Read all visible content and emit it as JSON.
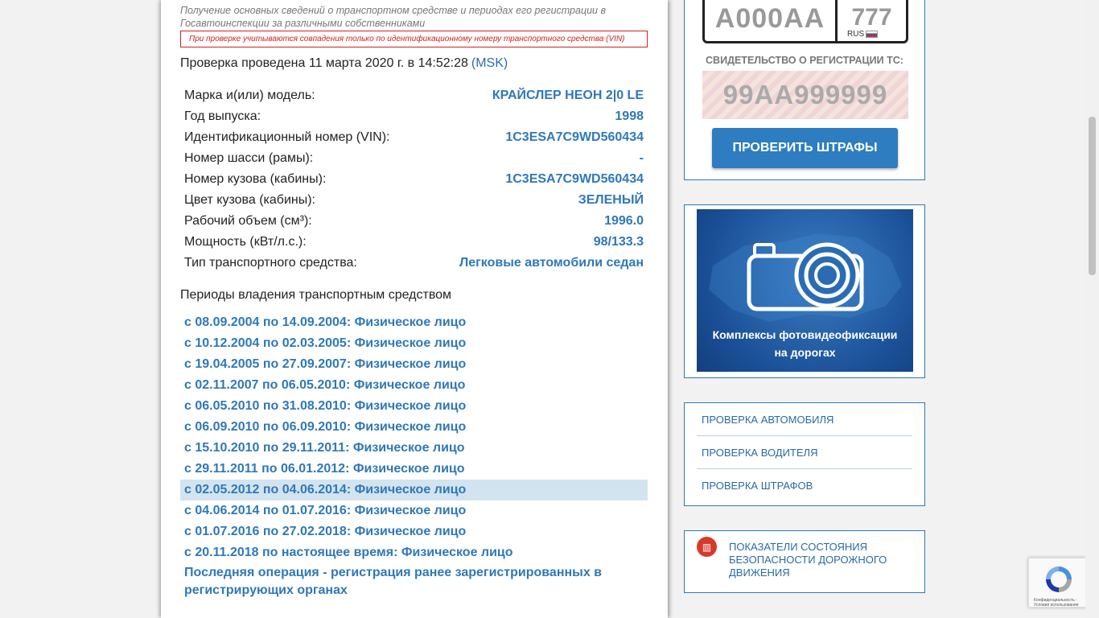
{
  "report": {
    "intro": "Получение основных сведений о транспортном средстве и периодах его регистрации в Госавтоинспекции за различными собственниками",
    "vin_note": "При проверке учитываются совпадения только по идентификационному номеру транспортного средства (VIN)",
    "check_time": "Проверка проведена 11 марта 2020 г. в 14:52:28",
    "timezone": "(MSK)"
  },
  "vehicle": [
    {
      "label": "Марка и(или) модель:",
      "value": "КРАЙСЛЕР НЕОН 2|0 LE"
    },
    {
      "label": "Год выпуска:",
      "value": "1998"
    },
    {
      "label": "Идентификационный номер (VIN):",
      "value": "1C3ESA7C9WD560434"
    },
    {
      "label": "Номер шасси (рамы):",
      "value": "-"
    },
    {
      "label": "Номер кузова (кабины):",
      "value": "1C3ESA7C9WD560434"
    },
    {
      "label": "Цвет кузова (кабины):",
      "value": "ЗЕЛЕНЫЙ"
    },
    {
      "label": "Рабочий объем (см³):",
      "value": "1996.0"
    },
    {
      "label": "Мощность (кВт/л.с.):",
      "value": "98/133.3"
    },
    {
      "label": "Тип транспортного средства:",
      "value": "Легковые автомобили седан"
    }
  ],
  "ownership": {
    "title": "Периоды владения транспортным средством",
    "periods": [
      "с 08.09.2004 по 14.09.2004: Физическое лицо",
      "с 10.12.2004 по 02.03.2005: Физическое лицо",
      "с 19.04.2005 по 27.09.2007: Физическое лицо",
      "с 02.11.2007 по 06.05.2010: Физическое лицо",
      "с 06.05.2010 по 31.08.2010: Физическое лицо",
      "с 06.09.2010 по 06.09.2010: Физическое лицо",
      "с 15.10.2010 по 29.11.2011: Физическое лицо",
      "с 29.11.2011 по 06.01.2012: Физическое лицо",
      "с 02.05.2012 по 04.06.2014: Физическое лицо",
      "с 04.06.2014 по 01.07.2016: Физическое лицо",
      "с 01.07.2016 по 27.02.2018: Физическое лицо",
      "с 20.11.2018 по настоящее время: Физическое лицо"
    ],
    "highlighted_index": 8,
    "last_operation": "Последняя операция - регистрация ранее зарегистрированных в регистрирующих органах"
  },
  "fines_widget": {
    "plate_number": "А000АА",
    "plate_region": "777",
    "plate_country": "RUS",
    "cert_label": "СВИДЕТЕЛЬСТВО О РЕГИСТРАЦИИ ТС:",
    "cert_number": "99АА999999",
    "button_label": "ПРОВЕРИТЬ ШТРАФЫ"
  },
  "camera_banner": {
    "line1": "Комплексы фотовидеофиксации",
    "line2": "на дорогах"
  },
  "links": [
    "ПРОВЕРКА АВТОМОБИЛЯ",
    "ПРОВЕРКА ВОДИТЕЛЯ",
    "ПРОВЕРКА ШТРАФОВ"
  ],
  "stats_widget": {
    "text": "ПОКАЗАТЕЛИ СОСТОЯНИЯ БЕЗОПАСНОСТИ ДОРОЖНОГО ДВИЖЕНИЯ"
  },
  "recaptcha": {
    "terms": "Конфиденциальность - Условия использования"
  },
  "colors": {
    "accent": "#2f78b8",
    "warning": "#d32020",
    "highlight_row": "#d2e4ef"
  }
}
